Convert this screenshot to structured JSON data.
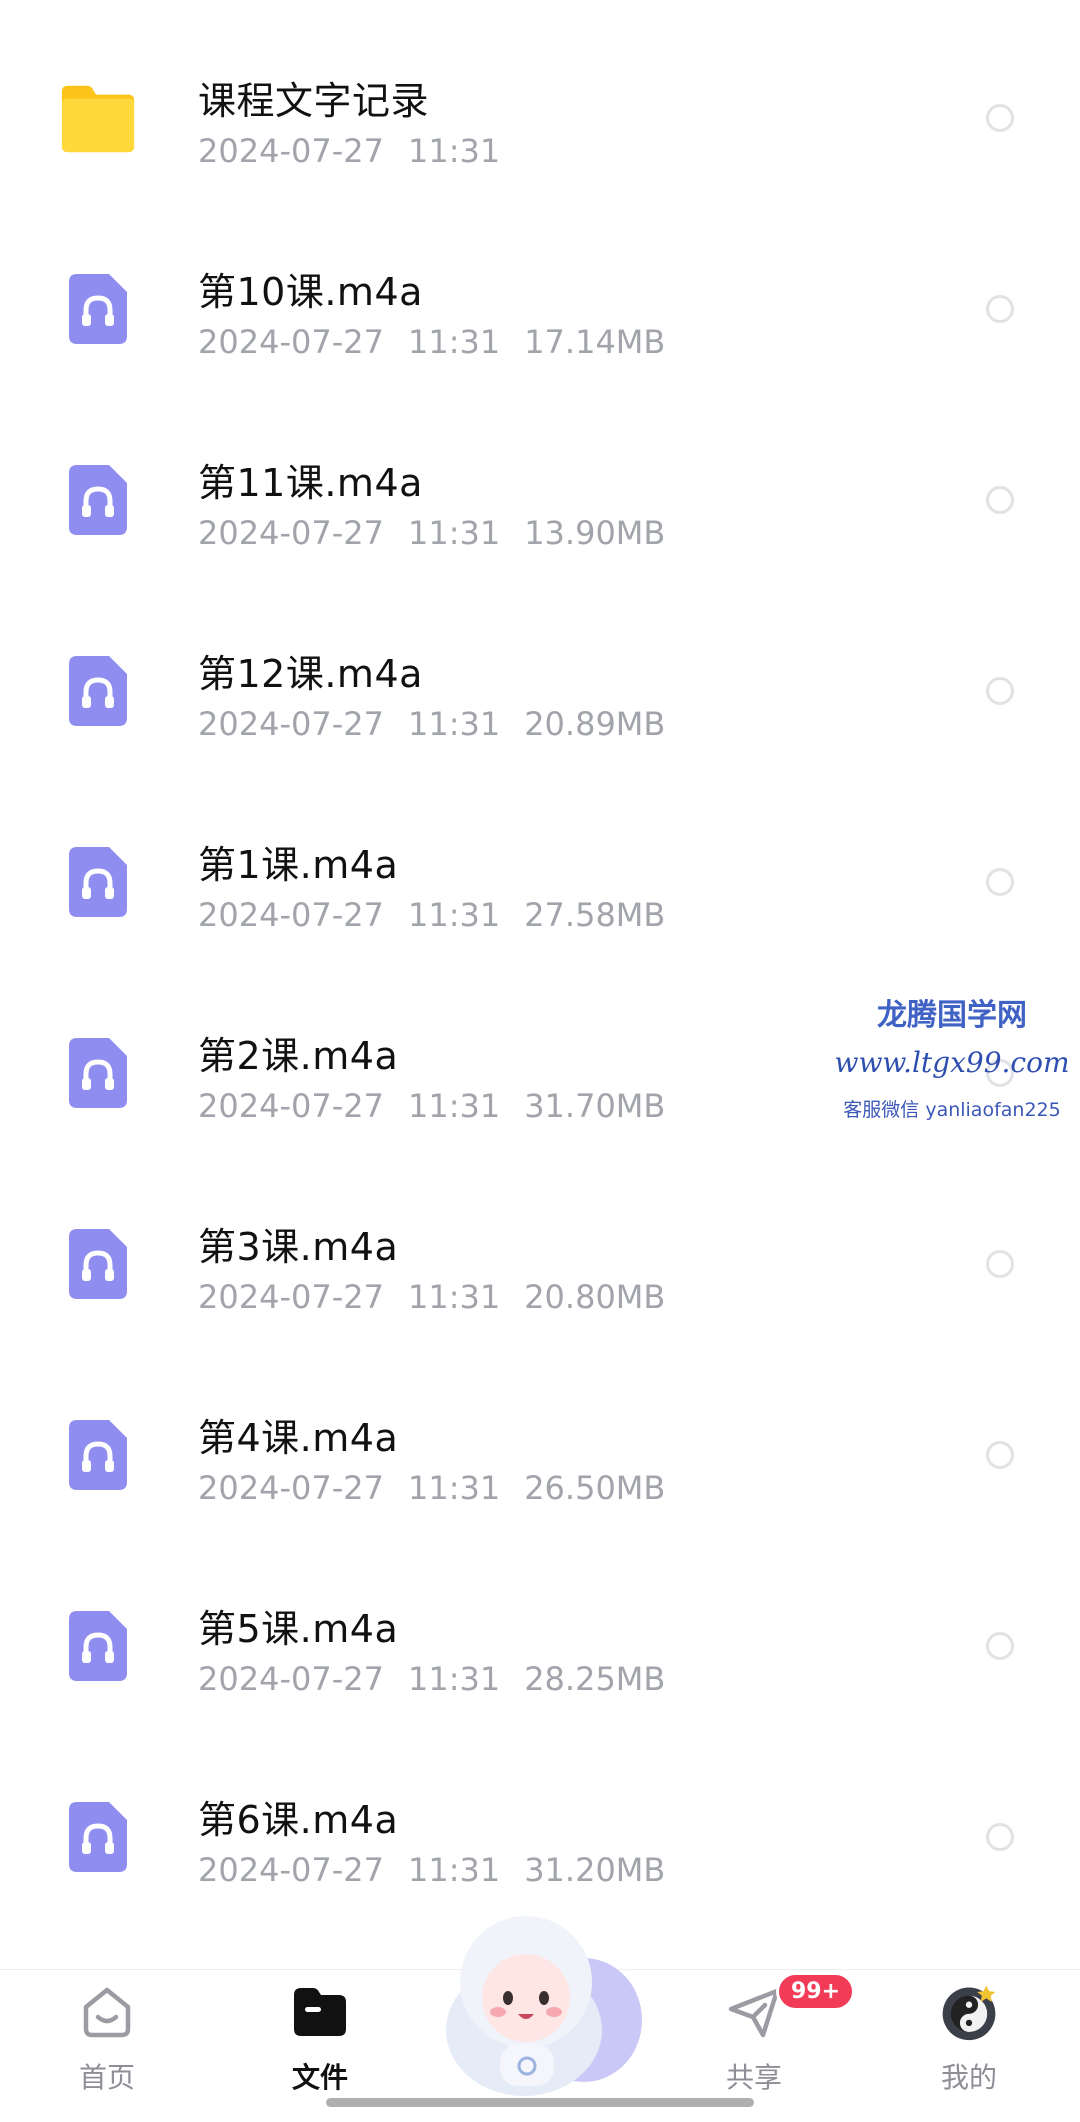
{
  "files": [
    {
      "name": "课程文字记录",
      "date": "2024-07-27",
      "time": "11:31",
      "size": "",
      "type": "folder"
    },
    {
      "name": "第10课.m4a",
      "date": "2024-07-27",
      "time": "11:31",
      "size": "17.14MB",
      "type": "audio"
    },
    {
      "name": "第11课.m4a",
      "date": "2024-07-27",
      "time": "11:31",
      "size": "13.90MB",
      "type": "audio"
    },
    {
      "name": "第12课.m4a",
      "date": "2024-07-27",
      "time": "11:31",
      "size": "20.89MB",
      "type": "audio"
    },
    {
      "name": "第1课.m4a",
      "date": "2024-07-27",
      "time": "11:31",
      "size": "27.58MB",
      "type": "audio"
    },
    {
      "name": "第2课.m4a",
      "date": "2024-07-27",
      "time": "11:31",
      "size": "31.70MB",
      "type": "audio"
    },
    {
      "name": "第3课.m4a",
      "date": "2024-07-27",
      "time": "11:31",
      "size": "20.80MB",
      "type": "audio"
    },
    {
      "name": "第4课.m4a",
      "date": "2024-07-27",
      "time": "11:31",
      "size": "26.50MB",
      "type": "audio"
    },
    {
      "name": "第5课.m4a",
      "date": "2024-07-27",
      "time": "11:31",
      "size": "28.25MB",
      "type": "audio"
    },
    {
      "name": "第6课.m4a",
      "date": "2024-07-27",
      "time": "11:31",
      "size": "31.20MB",
      "type": "audio"
    }
  ],
  "watermark": {
    "line1": "龙腾国学网",
    "line2": "www.ltgx99.com",
    "line3": "客服微信 yanliaofan225"
  },
  "tabbar": {
    "home": "首页",
    "files": "文件",
    "share": "共享",
    "share_badge": "99+",
    "me": "我的",
    "active": "files"
  },
  "icons": {
    "folder": "folder-icon",
    "audio": "audio-file-icon",
    "home": "home-icon",
    "files": "files-icon",
    "share": "send-icon",
    "me": "yin-yang-avatar-icon"
  },
  "colors": {
    "folder": "#fdd231",
    "audio": "#8f8df0",
    "badge": "#f23b57",
    "meta_text": "#a2a4ab"
  }
}
